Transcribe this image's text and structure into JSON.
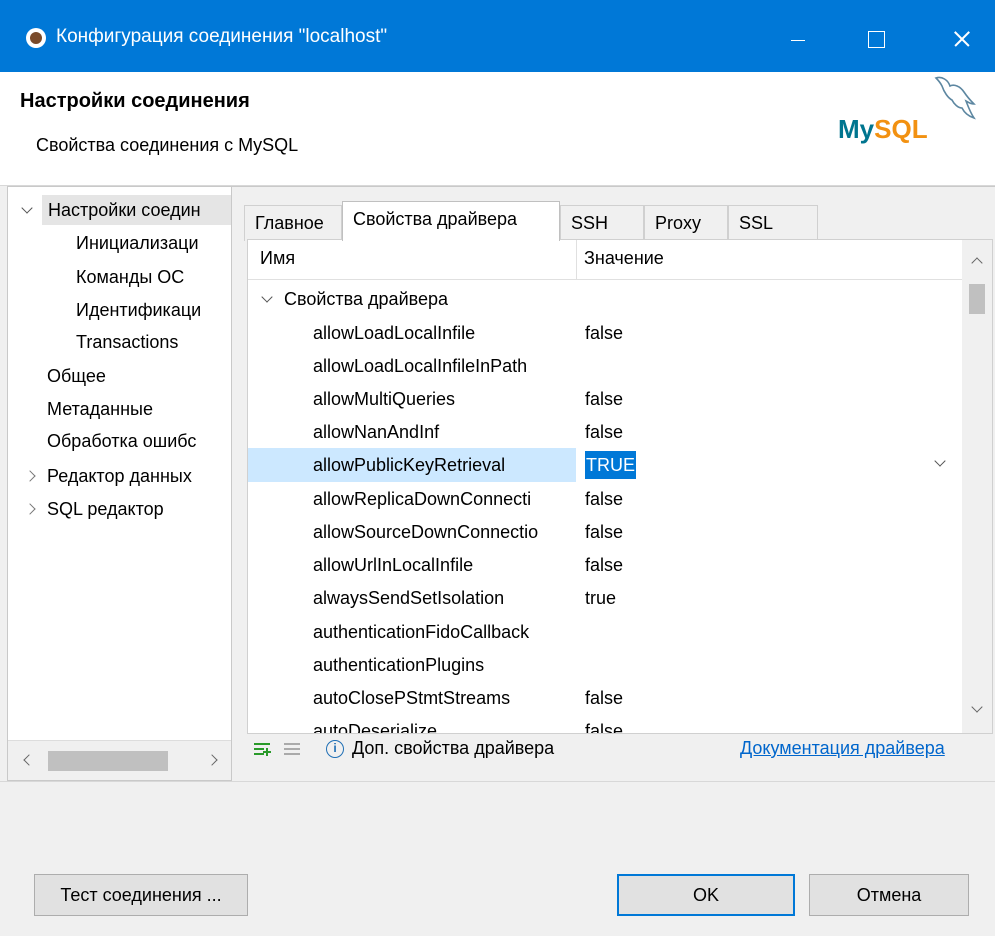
{
  "window": {
    "title": "Конфигурация соединения \"localhost\""
  },
  "header": {
    "title": "Настройки соединения",
    "subtitle": "Свойства соединения с MySQL",
    "logo_text_my": "My",
    "logo_text_sql": "SQL"
  },
  "nav": {
    "items": [
      {
        "label": "Настройки соедин"
      },
      {
        "label": "Инициализаци"
      },
      {
        "label": "Команды ОС"
      },
      {
        "label": "Идентификаци"
      },
      {
        "label": "Transactions"
      },
      {
        "label": "Общее"
      },
      {
        "label": "Метаданные"
      },
      {
        "label": "Обработка ошибс"
      },
      {
        "label": "Редактор данных"
      },
      {
        "label": "SQL редактор"
      }
    ]
  },
  "tabs": [
    "Главное",
    "Свойства драйвера",
    "SSH",
    "Proxy",
    "SSL"
  ],
  "table": {
    "col_name": "Имя",
    "col_value": "Значение",
    "group": "Свойства драйвера",
    "rows": [
      {
        "name": "allowLoadLocalInfile",
        "value": "false"
      },
      {
        "name": "allowLoadLocalInfileInPath",
        "value": ""
      },
      {
        "name": "allowMultiQueries",
        "value": "false"
      },
      {
        "name": "allowNanAndInf",
        "value": "false"
      },
      {
        "name": "allowPublicKeyRetrieval",
        "value": "TRUE"
      },
      {
        "name": "allowReplicaDownConnecti",
        "value": "false"
      },
      {
        "name": "allowSourceDownConnectio",
        "value": "false"
      },
      {
        "name": "allowUrlInLocalInfile",
        "value": "false"
      },
      {
        "name": "alwaysSendSetIsolation",
        "value": "true"
      },
      {
        "name": "authenticationFidoCallback",
        "value": ""
      },
      {
        "name": "authenticationPlugins",
        "value": ""
      },
      {
        "name": "autoClosePStmtStreams",
        "value": "false"
      },
      {
        "name": "autoDeserialize",
        "value": "false"
      }
    ]
  },
  "tools": {
    "add_icon": "add-property-icon",
    "remove_icon": "remove-property-icon",
    "info_icon": "info-icon",
    "extra_label": "Доп. свойства драйвера",
    "doc_link": "Документация драйвера"
  },
  "buttons": {
    "test": "Тест соединения ...",
    "ok": "OK",
    "cancel": "Отмена"
  },
  "colors": {
    "titlebar": "#0078d7",
    "selection": "#cce8ff",
    "value_highlight": "#0078d7",
    "link": "#0066cc"
  }
}
